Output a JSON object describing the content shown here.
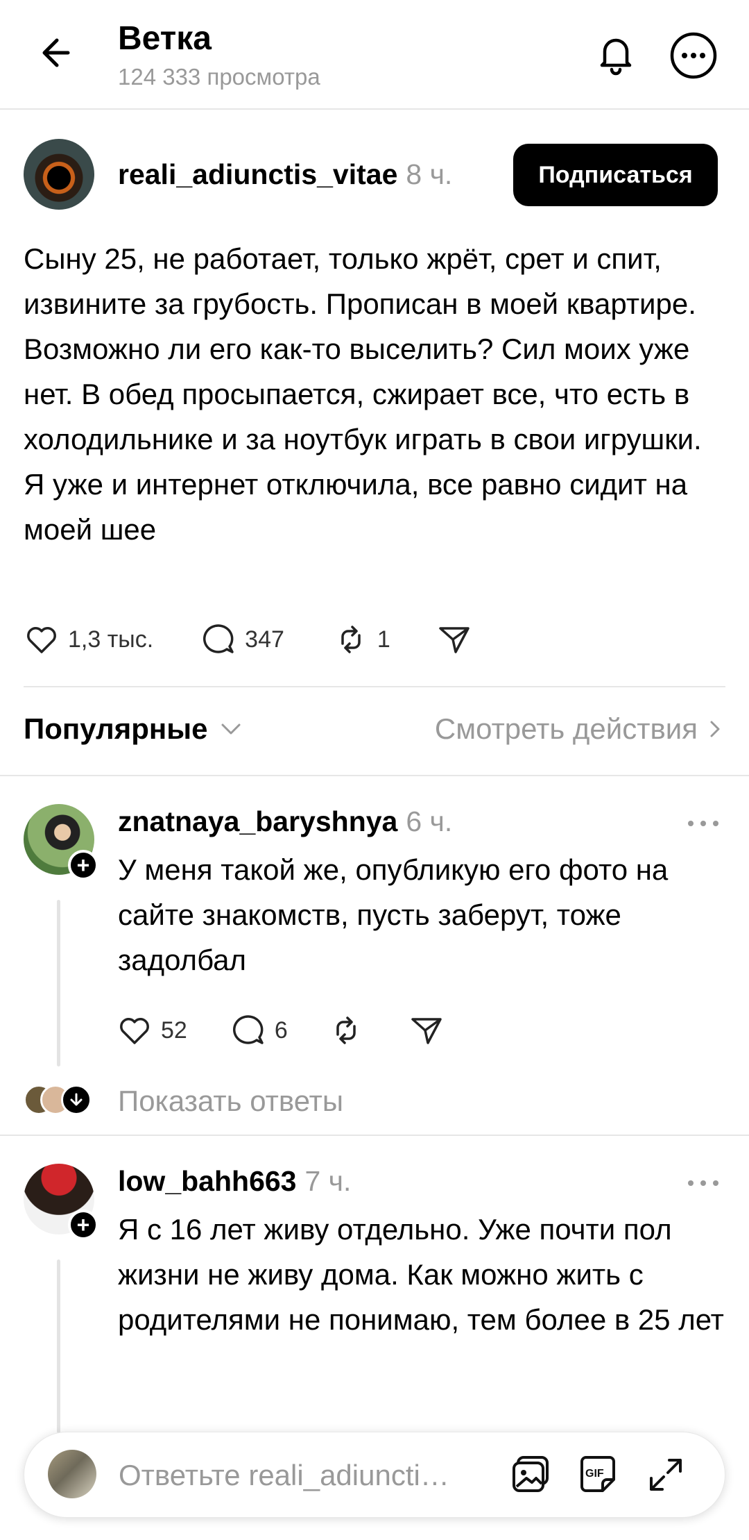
{
  "header": {
    "title": "Ветка",
    "views": "124 333 просмотра"
  },
  "post": {
    "username": "reali_adiunctis_vitae",
    "time": "8 ч.",
    "follow_label": "Подписаться",
    "text": "Сыну 25, не работает, только жрёт, срет и спит, извините за грубость. Прописан в моей квартире. Возможно ли его как-то выселить? Сил моих уже нет. В обед просыпается, сжирает все, что есть в холодильнике и за ноутбук играть в свои игрушки. Я уже и интернет отключила, все равно сидит на моей шее",
    "likes": "1,3 тыс.",
    "comments": "347",
    "reposts": "1"
  },
  "filter": {
    "sort_label": "Популярные",
    "activity_label": "Смотреть действия"
  },
  "comments": [
    {
      "username": "znatnaya_baryshnya",
      "time": "6 ч.",
      "text": "У меня такой же, опубликую его фото на сайте знакомств, пусть заберут, тоже задолбал",
      "likes": "52",
      "replies": "6"
    },
    {
      "username": "low_bahh663",
      "time": "7 ч.",
      "text": "Я с 16 лет живу отдельно. Уже почти пол жизни не живу дома. Как можно жить с родителями не понимаю, тем более в 25 лет"
    }
  ],
  "show_replies_label": "Показать ответы",
  "composer": {
    "placeholder": "Ответьте reali_adiuncti…"
  },
  "icons": {
    "back": "arrow-left-icon",
    "notifications": "bell-icon",
    "more": "more-horizontal-icon",
    "like": "heart-icon",
    "comment": "speech-bubble-icon",
    "repost": "repost-icon",
    "share": "send-icon",
    "media": "gallery-icon",
    "gif": "gif-icon",
    "expand": "expand-icon"
  }
}
